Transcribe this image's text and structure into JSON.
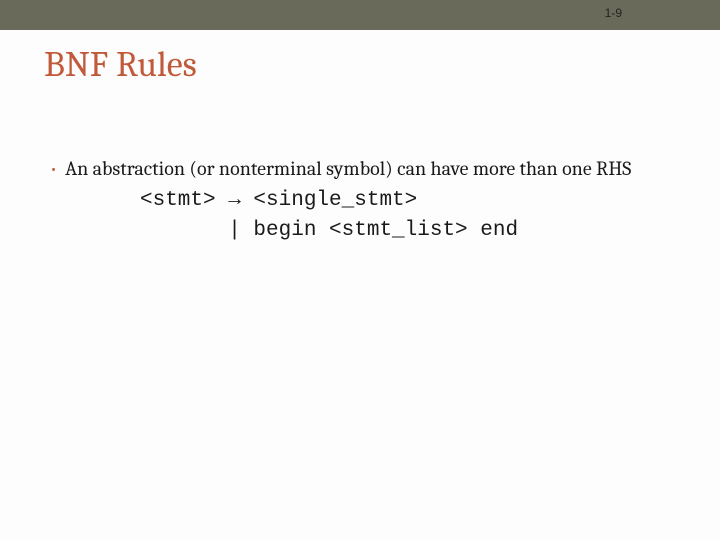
{
  "page_number": "1-9",
  "title": "BNF Rules",
  "bullet": {
    "text": "An abstraction (or nonterminal symbol) can have more than one RHS"
  },
  "code": {
    "line1": "<stmt> → <single_stmt>",
    "line2": "       | begin <stmt_list> end"
  }
}
